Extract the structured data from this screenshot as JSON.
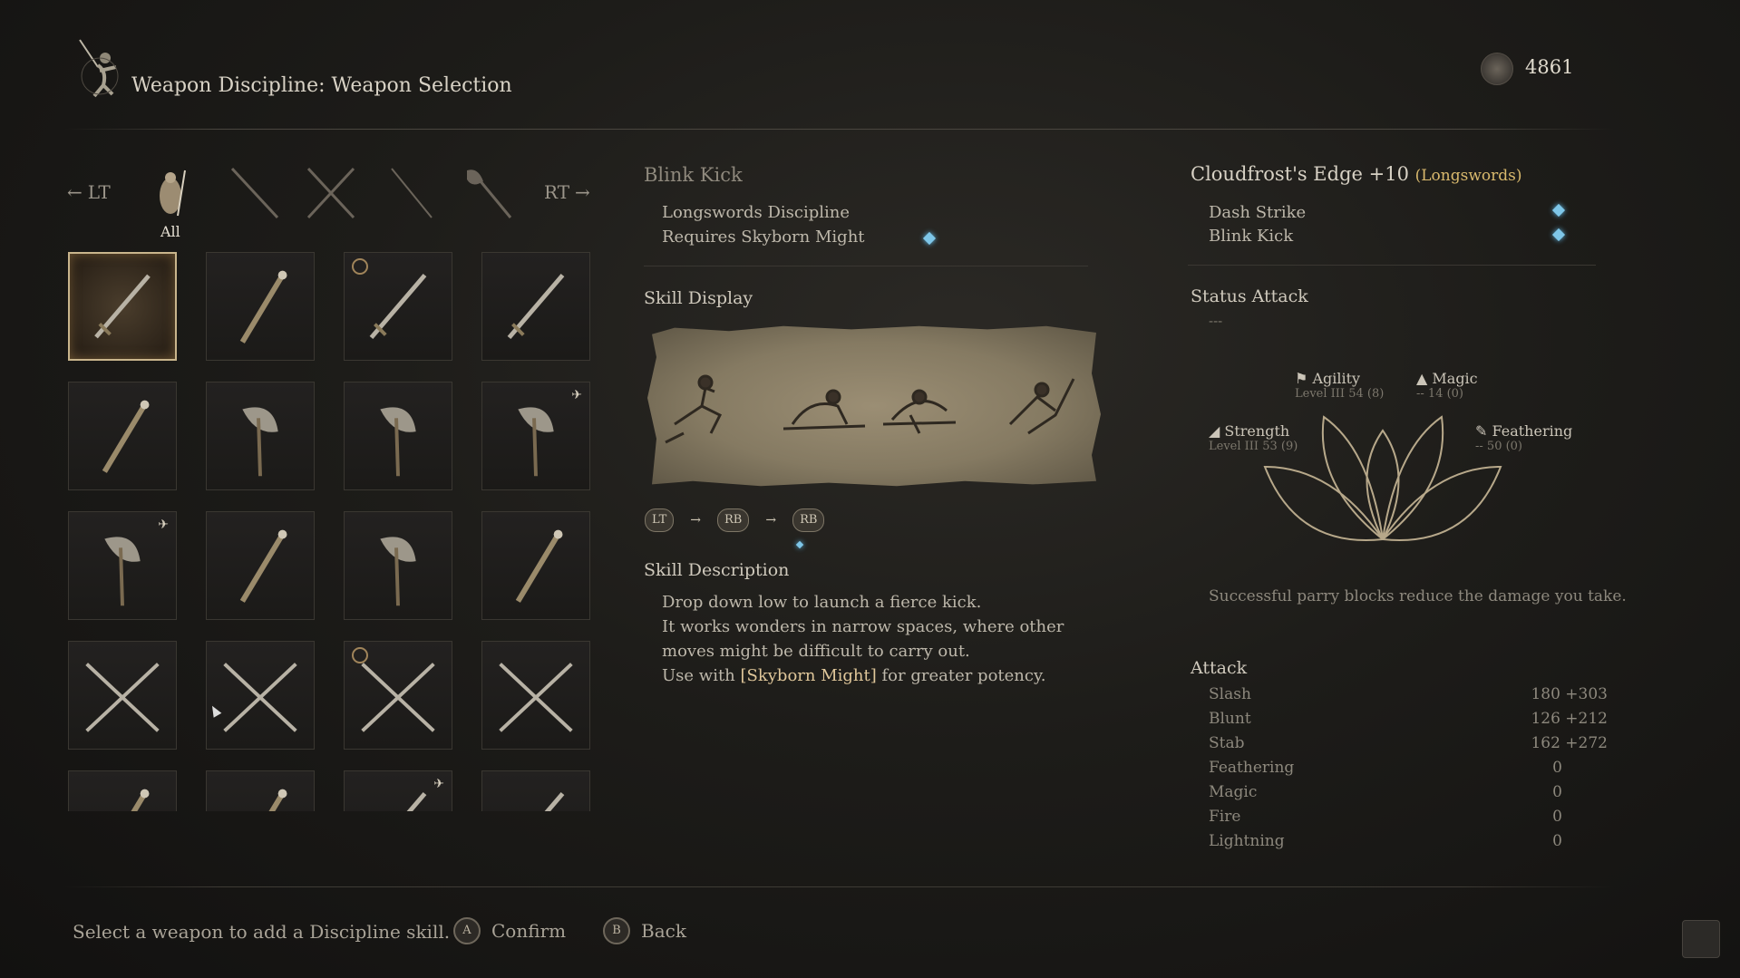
{
  "header": {
    "title": "Weapon Discipline: Weapon Selection",
    "icon": "warrior-emblem-icon",
    "currency_icon": "spirit-coin-icon",
    "currency_value": "4861"
  },
  "tabs": {
    "left_hint": "LT",
    "right_hint": "RT",
    "categories": [
      {
        "icon": "all-weapons-icon",
        "label": "All",
        "selected": true
      },
      {
        "icon": "staff-icon"
      },
      {
        "icon": "dual-blades-icon"
      },
      {
        "icon": "spear-icon"
      },
      {
        "icon": "axe-icon"
      }
    ]
  },
  "weapon_grid": [
    {
      "icon": "longsword-icon",
      "selected": true
    },
    {
      "icon": "ring-staff-icon"
    },
    {
      "icon": "ornate-sword-icon",
      "marker": "equipped-ring-icon"
    },
    {
      "icon": "dark-blade-icon"
    },
    {
      "icon": "mace-icon"
    },
    {
      "icon": "battle-axe-icon"
    },
    {
      "icon": "moon-axe-icon"
    },
    {
      "icon": "moon-axe-icon",
      "marker": "bird-icon"
    },
    {
      "icon": "war-axe-icon",
      "marker": "bird-icon"
    },
    {
      "icon": "claw-gauntlet-icon"
    },
    {
      "icon": "hatchet-icon"
    },
    {
      "icon": "octopus-staff-icon"
    },
    {
      "icon": "twin-hook-swords-icon"
    },
    {
      "icon": "crossed-blades-icon"
    },
    {
      "icon": "crossed-hooks-icon",
      "marker": "equipped-ring-icon"
    },
    {
      "icon": "dragon-blades-icon"
    },
    {
      "icon": "twin-maces-icon"
    },
    {
      "icon": "short-staff-icon"
    },
    {
      "icon": "short-sword-icon",
      "marker": "bird-icon"
    },
    {
      "icon": "dagger-icon"
    }
  ],
  "skill": {
    "name": "Blink Kick",
    "discipline": "Longswords Discipline",
    "requirement": "Requires Skyborn Might",
    "display_heading": "Skill Display",
    "combo": [
      "LT",
      "RB",
      "RB"
    ],
    "description_heading": "Skill Description",
    "description_lines": [
      "Drop down low to launch a fierce kick.",
      "It works wonders in narrow spaces, where other",
      "moves might be difficult to carry out."
    ],
    "description_last_prefix": "Use with ",
    "description_last_highlight": "[Skyborn Might]",
    "description_last_suffix": " for greater potency."
  },
  "weapon": {
    "name": "Cloudfrost's Edge +10",
    "type": "(Longswords)",
    "skills": [
      "Dash Strike",
      "Blink Kick"
    ],
    "status_heading": "Status Attack",
    "status_value": "---",
    "attributes": [
      {
        "name": "Agility",
        "detail": "Level III 54 (8)",
        "icon": "agility-icon"
      },
      {
        "name": "Magic",
        "detail": "-- 14 (0)",
        "icon": "magic-icon"
      },
      {
        "name": "Strength",
        "detail": "Level III 53 (9)",
        "icon": "strength-icon"
      },
      {
        "name": "Feathering",
        "detail": "-- 50 (0)",
        "icon": "feathering-icon"
      }
    ],
    "tip": "Successful parry blocks reduce the damage you take.",
    "attack_heading": "Attack",
    "attack": [
      {
        "name": "Slash",
        "value": "180 +303"
      },
      {
        "name": "Blunt",
        "value": "126 +212"
      },
      {
        "name": "Stab",
        "value": "162 +272"
      },
      {
        "name": "Feathering",
        "value": "0"
      },
      {
        "name": "Magic",
        "value": "0"
      },
      {
        "name": "Fire",
        "value": "0"
      },
      {
        "name": "Lightning",
        "value": "0"
      }
    ]
  },
  "footer": {
    "hint": "Select a weapon to add a Discipline skill.",
    "confirm_key": "A",
    "confirm_label": "Confirm",
    "back_key": "B",
    "back_label": "Back"
  },
  "colors": {
    "accent_gold": "#d9b96d",
    "diamond_blue": "#7ec6e8",
    "selected_border": "#c9b58c"
  }
}
